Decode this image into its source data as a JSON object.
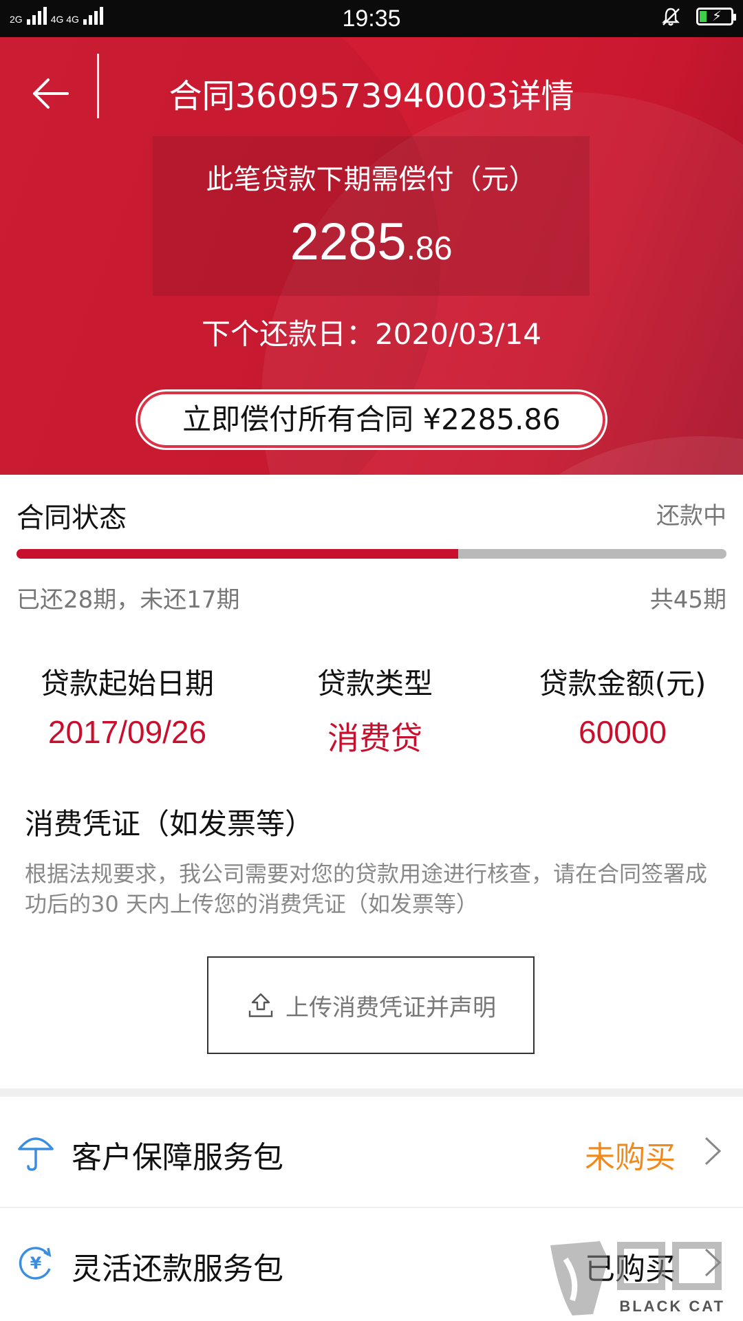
{
  "statusbar": {
    "left_signal": "2G",
    "left_signal2": "4G 4G",
    "time": "19:35"
  },
  "header": {
    "title": "合同3609573940003详情"
  },
  "due": {
    "label": "此笔贷款下期需偿付（元）",
    "amount_int": "2285",
    "amount_dec": ".86",
    "next_date_label": "下个还款日：2020/03/14"
  },
  "pay_all_button": "立即偿付所有合同 ¥2285.86",
  "status": {
    "title": "合同状态",
    "value": "还款中",
    "paid_text": "已还28期，未还17期",
    "total_text": "共45期",
    "progress_fraction": 0.622
  },
  "info": {
    "start_label": "贷款起始日期",
    "start_value": "2017/09/26",
    "type_label": "贷款类型",
    "type_value": "消费贷",
    "amount_label": "贷款金额(元)",
    "amount_value": "60000"
  },
  "voucher": {
    "title": "消费凭证（如发票等）",
    "desc": "根据法规要求，我公司需要对您的贷款用途进行核查，请在合同签署成功后的30 天内上传您的消费凭证（如发票等）",
    "upload_label": "上传消费凭证并声明"
  },
  "services": [
    {
      "label": "客户保障服务包",
      "state": "未购买",
      "state_color": "#f08a1c",
      "icon": "umbrella-icon"
    },
    {
      "label": "灵活还款服务包",
      "state": "已购买",
      "state_color": "#111111",
      "icon": "yuan-refresh-icon"
    }
  ],
  "watermark": {
    "text": "BLACK CAT"
  },
  "colors": {
    "brand_red": "#c8102e",
    "hero_red": "#d51e35"
  }
}
